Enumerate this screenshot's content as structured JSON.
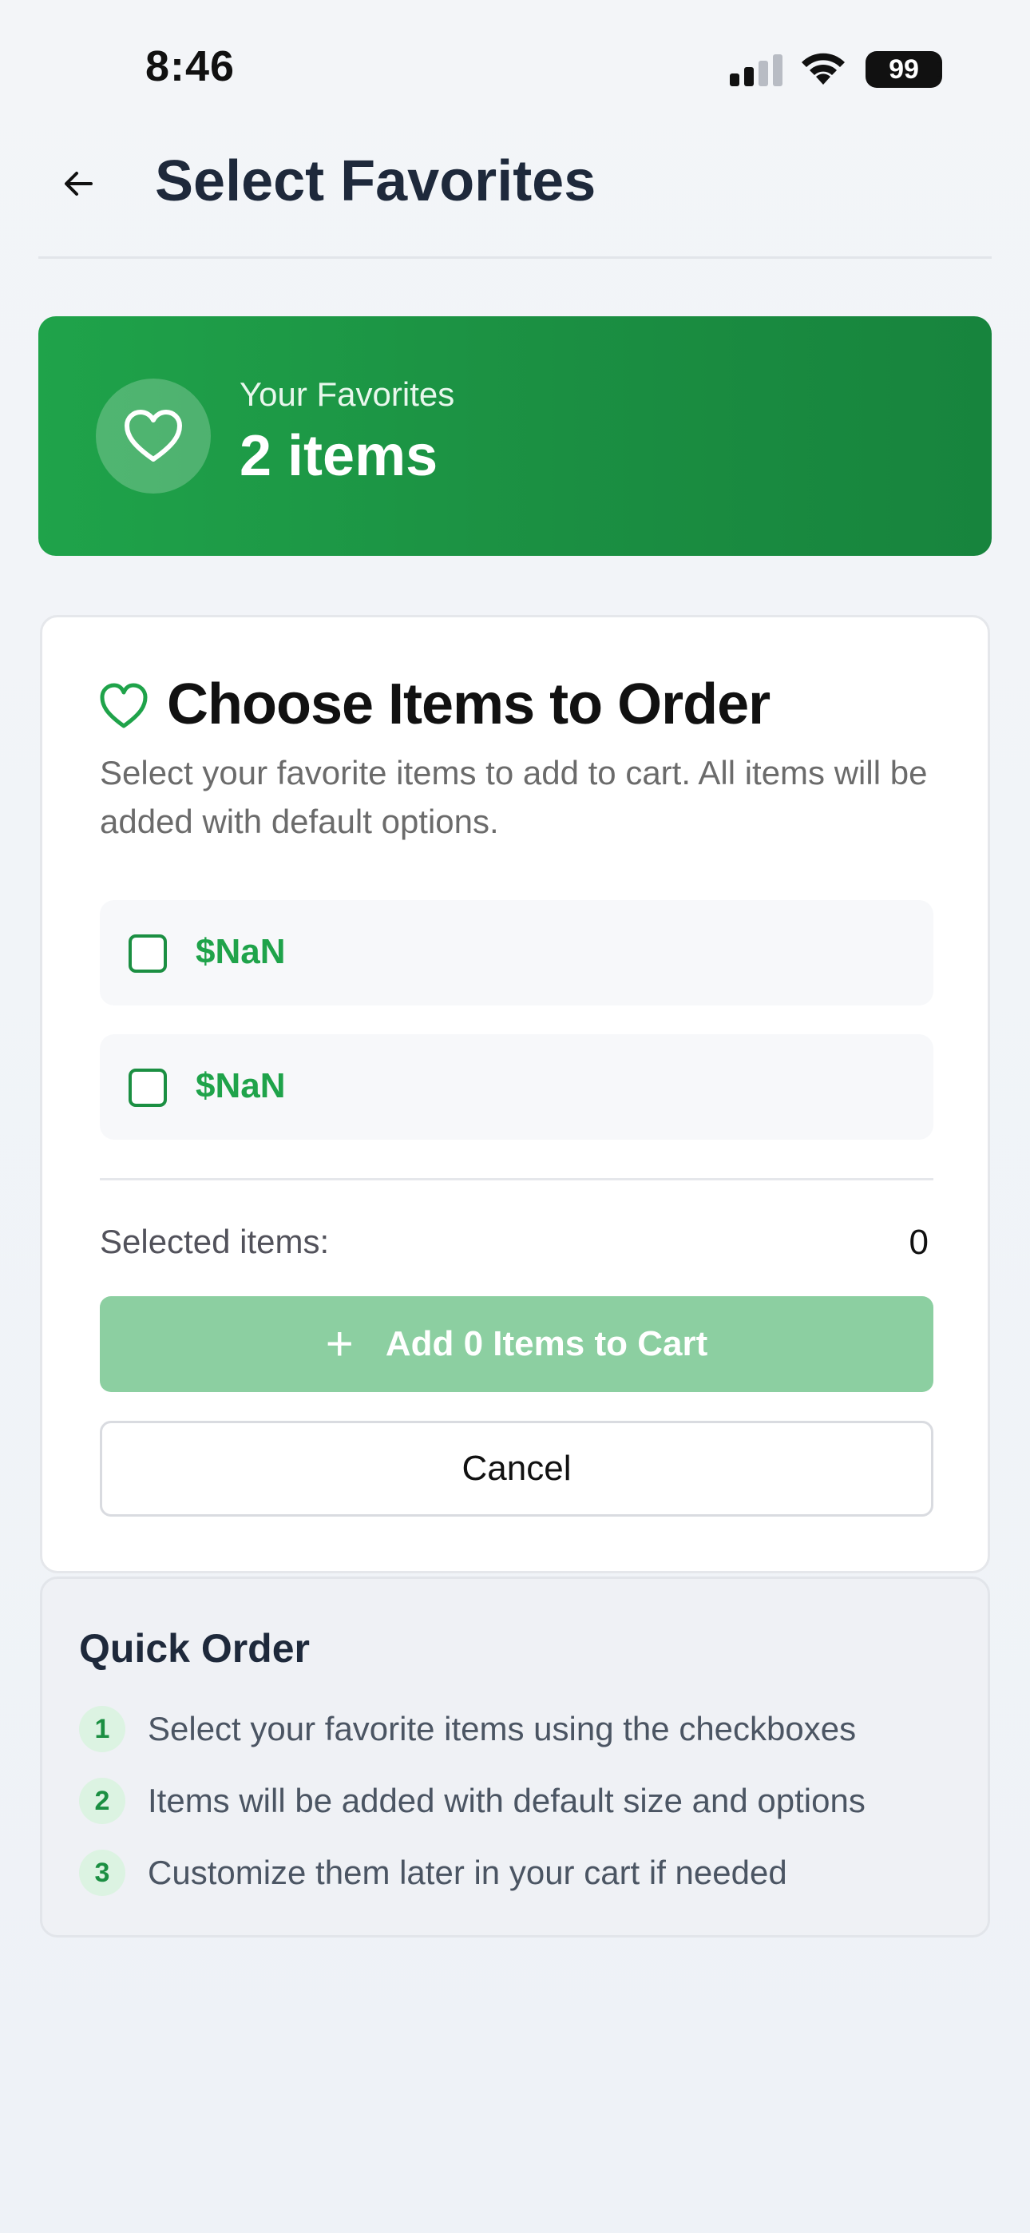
{
  "status": {
    "time": "8:46",
    "battery": "99"
  },
  "header": {
    "title": "Select Favorites",
    "back_icon": "arrow-left-icon"
  },
  "favorites": {
    "label": "Your Favorites",
    "count": "2 items",
    "icon": "heart-icon"
  },
  "card": {
    "title": "Choose Items to Order",
    "description": "Select your favorite items to add to cart. All items will be added with default options.",
    "items": [
      {
        "price": "$NaN",
        "checked": false
      },
      {
        "price": "$NaN",
        "checked": false
      }
    ],
    "selected_label": "Selected items:",
    "selected_count": "0",
    "add_button": "Add 0 Items to Cart",
    "cancel_button": "Cancel"
  },
  "quick_order": {
    "title": "Quick Order",
    "steps": [
      {
        "num": "1",
        "text": "Select your favorite items using the checkboxes"
      },
      {
        "num": "2",
        "text": "Items will be added with default size and options"
      },
      {
        "num": "3",
        "text": "Customize them later in your cart if needed"
      }
    ]
  },
  "colors": {
    "brand_green": "#1fa34a",
    "brand_green_dark": "#17843d",
    "disabled_green": "#8ccfa1"
  }
}
